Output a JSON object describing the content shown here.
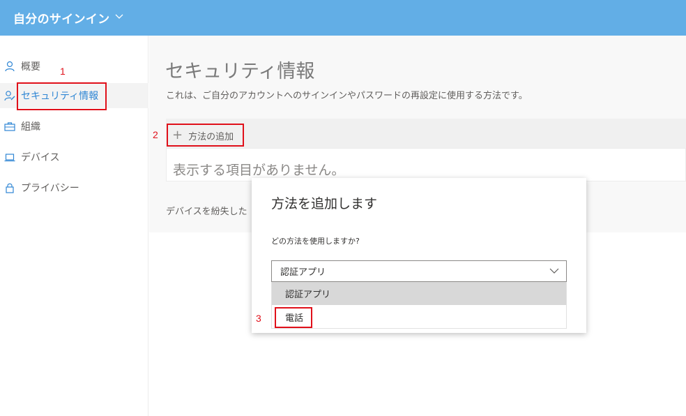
{
  "header": {
    "title": "自分のサインイン"
  },
  "sidebar": {
    "items": [
      {
        "label": "概要",
        "icon": "person-icon"
      },
      {
        "label": "セキュリティ情報",
        "icon": "security-info-icon"
      },
      {
        "label": "組織",
        "icon": "briefcase-icon"
      },
      {
        "label": "デバイス",
        "icon": "laptop-icon"
      },
      {
        "label": "プライバシー",
        "icon": "lock-icon"
      }
    ],
    "active_index": 1
  },
  "main": {
    "title": "セキュリティ情報",
    "subtitle": "これは、ご自分のアカウントへのサインインやパスワードの再設定に使用する方法です。",
    "add_method_label": "方法の追加",
    "empty_text": "表示する項目がありません。",
    "lost_device_text": "デバイスを紛失した"
  },
  "dialog": {
    "title": "方法を追加します",
    "question": "どの方法を使用しますか?",
    "selected_value": "認証アプリ",
    "options": [
      "認証アプリ",
      "電話"
    ]
  },
  "annotations": {
    "step1": "1",
    "step2": "2",
    "step3": "3"
  },
  "colors": {
    "header": "#62aee6",
    "accent": "#2f86d4",
    "annotation": "#e0101a"
  }
}
